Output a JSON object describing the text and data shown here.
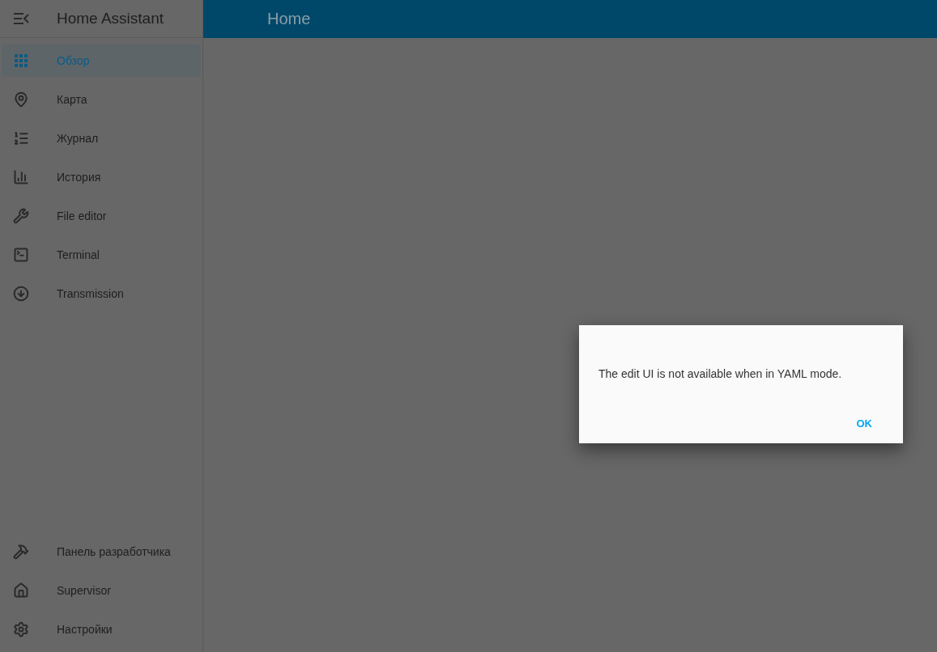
{
  "sidebar": {
    "title": "Home Assistant",
    "items": [
      {
        "label": "Обзор",
        "selected": true
      },
      {
        "label": "Карта",
        "selected": false
      },
      {
        "label": "Журнал",
        "selected": false
      },
      {
        "label": "История",
        "selected": false
      },
      {
        "label": "File editor",
        "selected": false
      },
      {
        "label": "Terminal",
        "selected": false
      },
      {
        "label": "Transmission",
        "selected": false
      }
    ],
    "bottom_items": [
      {
        "label": "Панель разработчика",
        "selected": false
      },
      {
        "label": "Supervisor",
        "selected": false
      },
      {
        "label": "Настройки",
        "selected": false
      }
    ]
  },
  "header": {
    "title": "Home"
  },
  "dialog": {
    "message": "The edit UI is not available when in YAML mode.",
    "button": "OK"
  }
}
